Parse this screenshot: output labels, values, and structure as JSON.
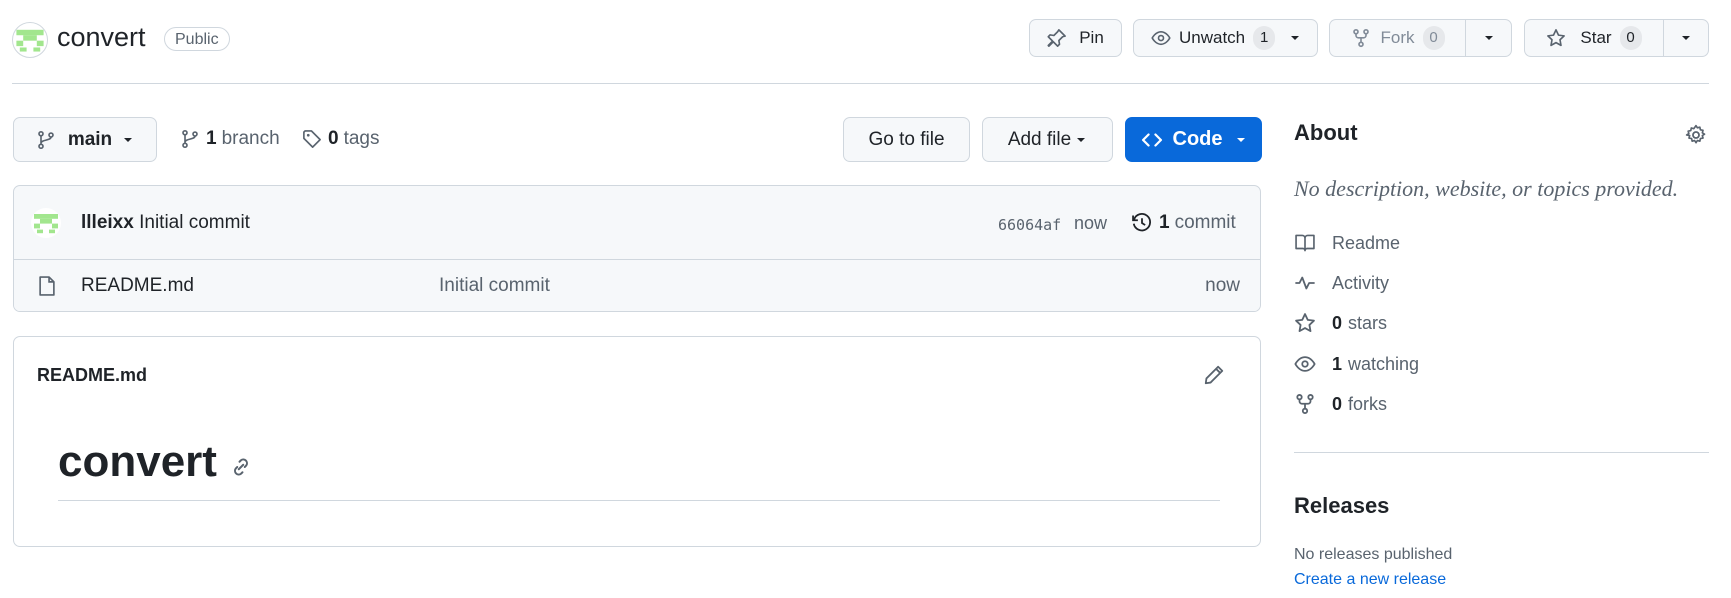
{
  "repo": {
    "name": "convert",
    "visibility": "Public"
  },
  "actions": {
    "pin_label": "Pin",
    "unwatch_label": "Unwatch",
    "unwatch_count": "1",
    "fork_label": "Fork",
    "fork_count": "0",
    "star_label": "Star",
    "star_count": "0"
  },
  "branch_bar": {
    "branch_name": "main",
    "branch_count": "1",
    "branch_word": "branch",
    "tag_count": "0",
    "tag_word": "tags",
    "go_to_file": "Go to file",
    "add_file": "Add file",
    "code": "Code"
  },
  "latest_commit": {
    "author": "llleixx",
    "message": "Initial commit",
    "sha": "66064af",
    "time": "now",
    "commit_count": "1",
    "commit_word": "commit"
  },
  "files": [
    {
      "name": "README.md",
      "message": "Initial commit",
      "time": "now"
    }
  ],
  "readme": {
    "filename": "README.md",
    "heading": "convert"
  },
  "about": {
    "title": "About",
    "description": "No description, website, or topics provided.",
    "readme_label": "Readme",
    "activity_label": "Activity",
    "stars_count": "0",
    "stars_word": "stars",
    "watching_count": "1",
    "watching_word": "watching",
    "forks_count": "0",
    "forks_word": "forks"
  },
  "releases": {
    "title": "Releases",
    "empty_text": "No releases published",
    "create_link": "Create a new release"
  },
  "colors": {
    "primary_button": "#0969da",
    "link": "#0969da",
    "border": "#d0d7de",
    "muted_text": "#59636e",
    "identicon": "#a2e68e"
  }
}
